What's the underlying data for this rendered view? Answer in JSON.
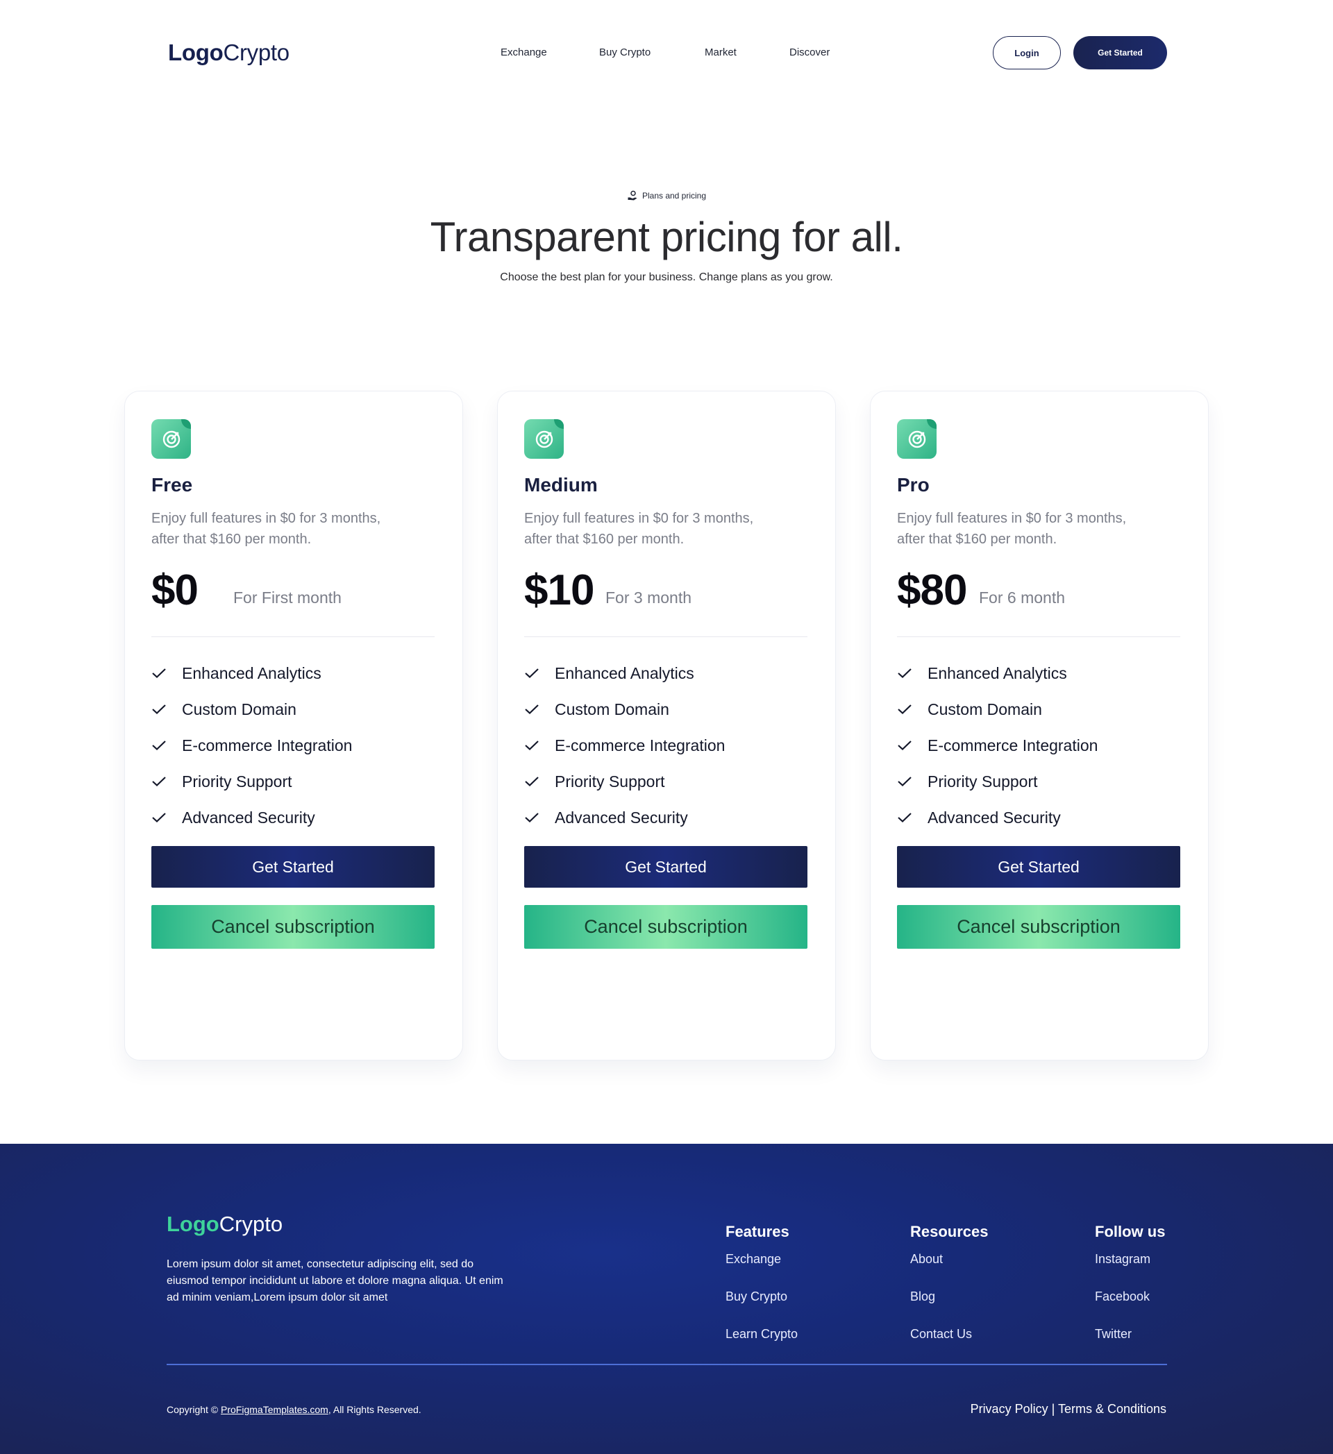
{
  "header": {
    "logo_bold": "Logo",
    "logo_light": "Crypto",
    "nav": [
      "Exchange",
      "Buy Crypto",
      "Market",
      "Discover"
    ],
    "login_label": "Login",
    "get_started_label": "Get Started"
  },
  "hero": {
    "tag": "Plans and pricing",
    "title": "Transparent pricing for all.",
    "subtitle": "Choose the best plan for your business. Change plans as you grow."
  },
  "plans": [
    {
      "name": "Free",
      "description": "Enjoy full features in $0 for 3 months, after that $160 per month.",
      "price": "$0",
      "period": "For First month",
      "features": [
        "Enhanced Analytics",
        "Custom Domain",
        "E-commerce Integration",
        "Priority Support",
        "Advanced Security"
      ],
      "primary_label": "Get Started",
      "secondary_label": "Cancel subscription"
    },
    {
      "name": "Medium",
      "description": "Enjoy full features in $0 for 3 months, after that $160 per month.",
      "price": "$10",
      "period": "For 3  month",
      "features": [
        "Enhanced Analytics",
        "Custom Domain",
        "E-commerce Integration",
        "Priority Support",
        "Advanced Security"
      ],
      "primary_label": "Get Started",
      "secondary_label": "Cancel subscription"
    },
    {
      "name": "Pro",
      "description": "Enjoy full features in $0 for 3 months, after that $160 per month.",
      "price": "$80",
      "period": "For 6 month",
      "features": [
        "Enhanced Analytics",
        "Custom Domain",
        "E-commerce Integration",
        "Priority Support",
        "Advanced Security"
      ],
      "primary_label": "Get Started",
      "secondary_label": "Cancel subscription"
    }
  ],
  "footer": {
    "logo_bold": "Logo",
    "logo_light": "Crypto",
    "about": "Lorem ipsum dolor sit amet, consectetur adipiscing elit, sed do eiusmod tempor incididunt ut labore et dolore magna aliqua. Ut enim ad minim veniam,Lorem ipsum dolor sit amet",
    "columns": [
      {
        "title": "Features",
        "links": [
          "Exchange",
          "Buy Crypto",
          "Learn Crypto"
        ]
      },
      {
        "title": "Resources",
        "links": [
          "About",
          "Blog",
          "Contact Us"
        ]
      },
      {
        "title": "Follow us",
        "links": [
          "Instagram",
          "Facebook",
          "Twitter"
        ]
      }
    ],
    "copyright_prefix": "Copyright © ",
    "copyright_site": "ProFigmaTemplates.com",
    "copyright_suffix": ", All Rights Reserved.",
    "legal": "Privacy Policy | Terms & Conditions"
  },
  "colors": {
    "navy": "#1a2350",
    "green": "#2fb386",
    "footer_bg": "#172a78"
  }
}
